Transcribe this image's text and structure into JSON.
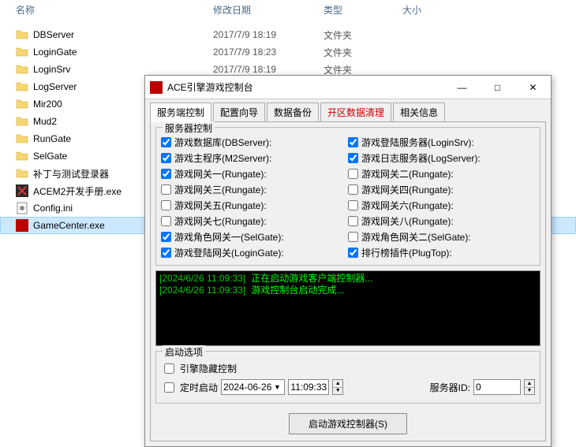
{
  "explorer": {
    "cols": {
      "name": "名称",
      "date": "修改日期",
      "type": "类型",
      "size": "大小"
    },
    "type_folder": "文件夹",
    "files": [
      {
        "name": "DBServer",
        "date": "2017/7/9 18:19",
        "type": "文件夹",
        "icon": "folder"
      },
      {
        "name": "LoginGate",
        "date": "2017/7/9 18:23",
        "type": "文件夹",
        "icon": "folder"
      },
      {
        "name": "LoginSrv",
        "date": "2017/7/9 18:19",
        "type": "文件夹",
        "icon": "folder"
      },
      {
        "name": "LogServer",
        "date": "",
        "type": "",
        "icon": "folder"
      },
      {
        "name": "Mir200",
        "date": "",
        "type": "",
        "icon": "folder"
      },
      {
        "name": "Mud2",
        "date": "",
        "type": "",
        "icon": "folder"
      },
      {
        "name": "RunGate",
        "date": "",
        "type": "",
        "icon": "folder"
      },
      {
        "name": "SelGate",
        "date": "",
        "type": "",
        "icon": "folder"
      },
      {
        "name": "补丁与测试登录器",
        "date": "",
        "type": "",
        "icon": "folder"
      },
      {
        "name": "ACEM2开发手册.exe",
        "date": "",
        "type": "",
        "icon": "exe-red"
      },
      {
        "name": "Config.ini",
        "date": "",
        "type": "",
        "icon": "ini"
      },
      {
        "name": "GameCenter.exe",
        "date": "",
        "type": "",
        "icon": "exe-app",
        "selected": true
      }
    ]
  },
  "dialog": {
    "title": "ACE引擎游戏控制台",
    "tabs": [
      "服务端控制",
      "配置向导",
      "数据备份",
      "开区数据清理",
      "相关信息"
    ],
    "group_servers": "服务器控制",
    "checks_left": [
      {
        "label": "游戏数据库(DBServer):",
        "checked": true
      },
      {
        "label": "游戏主程序(M2Server):",
        "checked": true
      },
      {
        "label": "游戏网关一(Rungate):",
        "checked": true
      },
      {
        "label": "游戏网关三(Rungate):",
        "checked": false
      },
      {
        "label": "游戏网关五(Rungate):",
        "checked": false
      },
      {
        "label": "游戏网关七(Rungate):",
        "checked": false
      },
      {
        "label": "游戏角色网关一(SelGate):",
        "checked": true
      },
      {
        "label": "游戏登陆网关(LoginGate):",
        "checked": true
      }
    ],
    "checks_right": [
      {
        "label": "游戏登陆服务器(LoginSrv):",
        "checked": true
      },
      {
        "label": "游戏日志服务器(LogServer):",
        "checked": true
      },
      {
        "label": "游戏网关二(Rungate):",
        "checked": false
      },
      {
        "label": "游戏网关四(Rungate):",
        "checked": false
      },
      {
        "label": "游戏网关六(Rungate):",
        "checked": false
      },
      {
        "label": "游戏网关八(Rungate):",
        "checked": false
      },
      {
        "label": "游戏角色网关二(SelGate):",
        "checked": false
      },
      {
        "label": "排行榜插件(PlugTop):",
        "checked": true
      }
    ],
    "console": [
      {
        "ts": "[2024/6/26 11:09:33]",
        "msg": "正在启动游戏客户端控制器..."
      },
      {
        "ts": "[2024/6/26 11:09:33]",
        "msg": "游戏控制台启动完成..."
      }
    ],
    "group_options": "启动选项",
    "hide_label": "引擎隐藏控制",
    "hide_checked": false,
    "timed_label": "定时启动",
    "timed_checked": false,
    "date_value": "2024-06-26",
    "time_value": "11:09:33",
    "server_id_label": "服务器ID:",
    "server_id_value": "0",
    "launch_label": "启动游戏控制器(S)"
  }
}
